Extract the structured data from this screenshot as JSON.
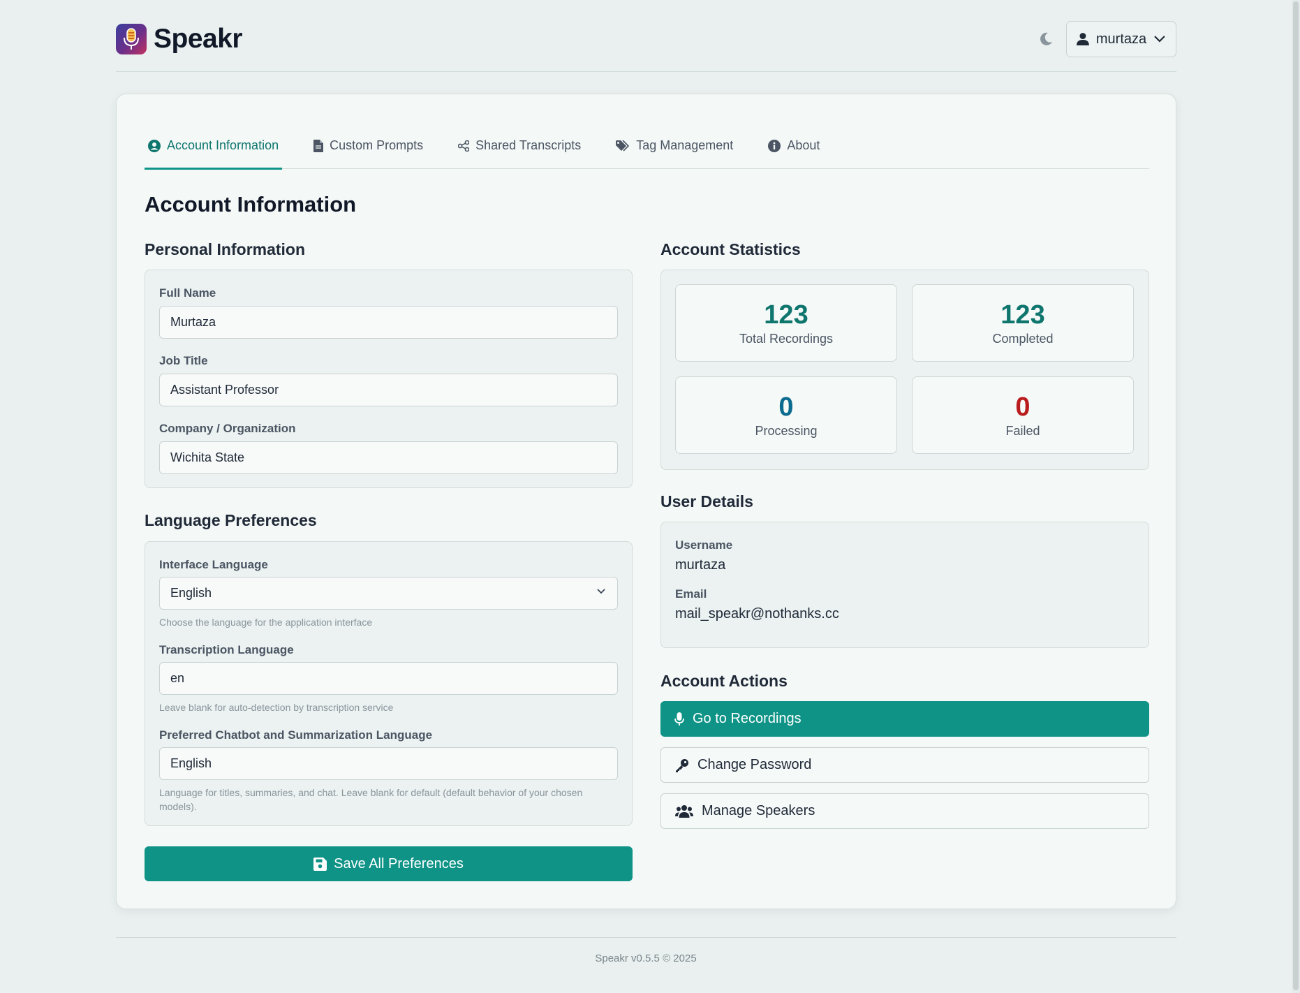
{
  "app": {
    "brand": "Speakr"
  },
  "header": {
    "username": "murtaza"
  },
  "tabs": [
    {
      "label": "Account Information",
      "icon": "user-circle-icon",
      "active": true
    },
    {
      "label": "Custom Prompts",
      "icon": "file-icon"
    },
    {
      "label": "Shared Transcripts",
      "icon": "share-icon"
    },
    {
      "label": "Tag Management",
      "icon": "tags-icon"
    },
    {
      "label": "About",
      "icon": "info-icon"
    }
  ],
  "page": {
    "title": "Account Information"
  },
  "personal": {
    "title": "Personal Information",
    "full_name_label": "Full Name",
    "full_name_value": "Murtaza",
    "job_title_label": "Job Title",
    "job_title_value": "Assistant Professor",
    "company_label": "Company / Organization",
    "company_value": "Wichita State"
  },
  "language": {
    "title": "Language Preferences",
    "interface_label": "Interface Language",
    "interface_value": "English",
    "interface_hint": "Choose the language for the application interface",
    "transcription_label": "Transcription Language",
    "transcription_value": "en",
    "transcription_hint": "Leave blank for auto-detection by transcription service",
    "chatbot_label": "Preferred Chatbot and Summarization Language",
    "chatbot_value": "English",
    "chatbot_hint": "Language for titles, summaries, and chat. Leave blank for default (default behavior of your chosen models)."
  },
  "save_label": "Save All Preferences",
  "stats": {
    "title": "Account Statistics",
    "total_value": "123",
    "total_label": "Total Recordings",
    "completed_value": "123",
    "completed_label": "Completed",
    "processing_value": "0",
    "processing_label": "Processing",
    "failed_value": "0",
    "failed_label": "Failed",
    "colors": {
      "total": "#0f766e",
      "completed": "#0f766e",
      "processing": "#0b6b8f",
      "failed": "#b91c1c"
    }
  },
  "user_details": {
    "title": "User Details",
    "username_label": "Username",
    "username_value": "murtaza",
    "email_label": "Email",
    "email_value": "mail_speakr@nothanks.cc"
  },
  "actions": {
    "title": "Account Actions",
    "recordings_label": "Go to Recordings",
    "password_label": "Change Password",
    "speakers_label": "Manage Speakers"
  },
  "footer": {
    "text": "Speakr v0.5.5 © 2025"
  },
  "colors": {
    "accent": "#0e9386",
    "background": "#e9f0ef"
  }
}
